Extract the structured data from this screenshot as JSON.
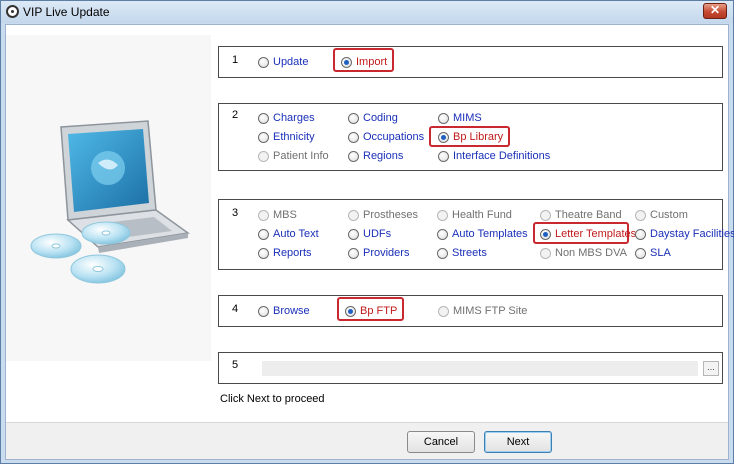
{
  "window": {
    "title": "VIP Live Update",
    "close_label": "✕"
  },
  "groups": [
    {
      "number": "1",
      "options": [
        {
          "label": "Update",
          "state": "enabled"
        },
        {
          "label": "Import",
          "state": "selected"
        }
      ]
    },
    {
      "number": "2",
      "options": [
        {
          "label": "Charges",
          "state": "enabled"
        },
        {
          "label": "Coding",
          "state": "enabled"
        },
        {
          "label": "MIMS",
          "state": "enabled"
        },
        {
          "label": "Ethnicity",
          "state": "enabled"
        },
        {
          "label": "Occupations",
          "state": "enabled"
        },
        {
          "label": "Bp Library",
          "state": "selected"
        },
        {
          "label": "Patient Info",
          "state": "disabled"
        },
        {
          "label": "Regions",
          "state": "enabled"
        },
        {
          "label": "Interface Definitions",
          "state": "enabled"
        }
      ]
    },
    {
      "number": "3",
      "options": [
        {
          "label": "MBS",
          "state": "disabled"
        },
        {
          "label": "Prostheses",
          "state": "disabled"
        },
        {
          "label": "Health Fund",
          "state": "disabled"
        },
        {
          "label": "Theatre Band",
          "state": "disabled"
        },
        {
          "label": "Custom",
          "state": "disabled"
        },
        {
          "label": "Auto Text",
          "state": "enabled"
        },
        {
          "label": "UDFs",
          "state": "enabled"
        },
        {
          "label": "Auto Templates",
          "state": "enabled"
        },
        {
          "label": "Letter Templates",
          "state": "selected"
        },
        {
          "label": "Daystay Facilities",
          "state": "enabled"
        },
        {
          "label": "Reports",
          "state": "enabled"
        },
        {
          "label": "Providers",
          "state": "enabled"
        },
        {
          "label": "Streets",
          "state": "enabled"
        },
        {
          "label": "Non MBS DVA",
          "state": "disabled"
        },
        {
          "label": "SLA",
          "state": "enabled"
        }
      ]
    },
    {
      "number": "4",
      "options": [
        {
          "label": "Browse",
          "state": "enabled"
        },
        {
          "label": "Bp FTP",
          "state": "selected"
        },
        {
          "label": "MIMS FTP Site",
          "state": "disabled"
        }
      ]
    },
    {
      "number": "5",
      "path_value": "",
      "browse_label": "..."
    }
  ],
  "hint": "Click Next to proceed",
  "buttons": {
    "cancel": "Cancel",
    "next": "Next"
  },
  "colors": {
    "enabled_text": "#1a2fb8",
    "selected_text": "#c01a1a",
    "highlight_border": "#c8282e",
    "disabled_text": "#707070"
  }
}
